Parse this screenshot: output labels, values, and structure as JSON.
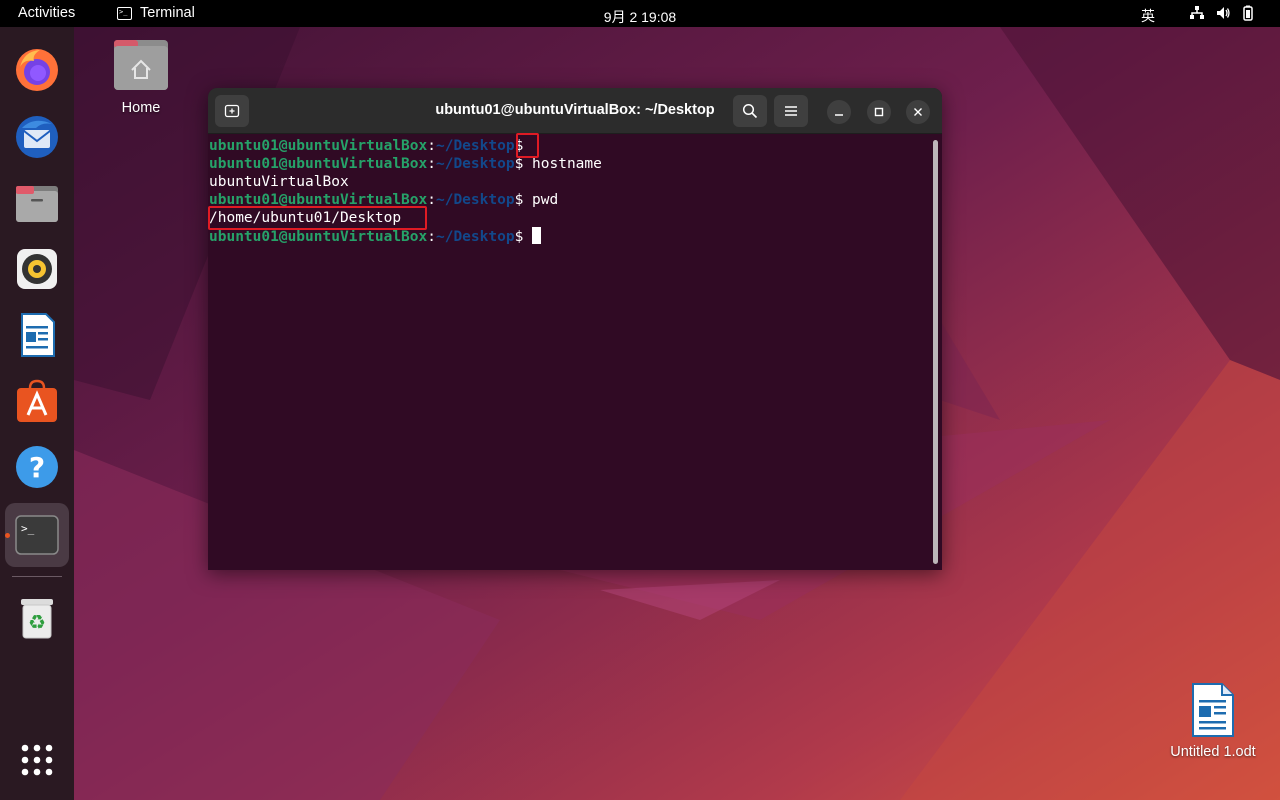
{
  "topbar": {
    "activities": "Activities",
    "app_name": "Terminal",
    "clock": "9月 2  19:08",
    "input_method": "英"
  },
  "desktop": {
    "home_label": "Home",
    "file_label": "Untitled 1.odt"
  },
  "terminal": {
    "title": "ubuntu01@ubuntuVirtualBox: ~/Desktop",
    "prompt_user": "ubuntu01@ubuntuVirtualBox",
    "prompt_sep": ":",
    "prompt_path": "~/Desktop",
    "prompt_dollar": "$",
    "lines": [
      {
        "type": "prompt",
        "cmd": ""
      },
      {
        "type": "prompt",
        "cmd": " hostname"
      },
      {
        "type": "output",
        "text": "ubuntuVirtualBox"
      },
      {
        "type": "prompt",
        "cmd": " pwd"
      },
      {
        "type": "output",
        "text": "/home/ubuntu01/Desktop"
      },
      {
        "type": "prompt",
        "cmd": " ",
        "cursor": true
      }
    ]
  },
  "dock": {
    "items": [
      "firefox-icon",
      "thunderbird-icon",
      "files-icon",
      "rhythmbox-icon",
      "writer-icon",
      "software-icon",
      "help-icon",
      "terminal-icon",
      "trash-icon",
      "app-grid-icon"
    ]
  },
  "colors": {
    "accent": "#e95420",
    "terminal_bg": "#300a24",
    "prompt_user": "#26a269",
    "prompt_path": "#12488b",
    "highlight": "#e01b24"
  }
}
